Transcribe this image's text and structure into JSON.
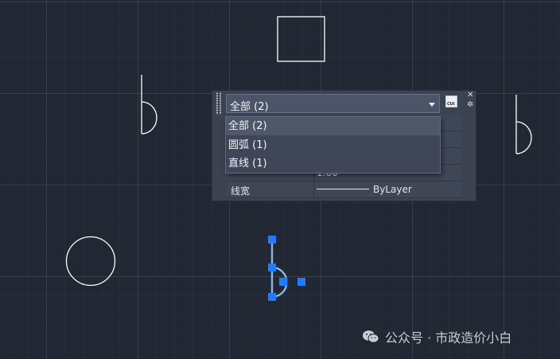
{
  "canvas": {
    "background_color": "#212733",
    "stroke_color": "#ffffff",
    "selection_color": "#3b8eea",
    "grip_color": "#1f7cff",
    "objects": [
      "rectangle",
      "arc-line-glyph",
      "arc-line-glyph",
      "circle",
      "selected-arc-line-glyph"
    ]
  },
  "quick_properties": {
    "selector_value": "全部 (2)",
    "cui_icon_label": "CUI",
    "close_icon": "close-icon",
    "settings_icon": "gear-icon",
    "rows": [
      {
        "label": "",
        "value": ""
      },
      {
        "label": "",
        "value": ""
      },
      {
        "label": "",
        "value": ""
      },
      {
        "label": "",
        "value": "1.00"
      },
      {
        "label": "线宽",
        "value": "ByLayer"
      }
    ]
  },
  "dropdown": {
    "items": [
      {
        "label": "全部 (2)",
        "selected": true
      },
      {
        "label": "圆弧 (1)",
        "selected": false
      },
      {
        "label": "直线 (1)",
        "selected": false
      }
    ]
  },
  "watermark": {
    "icon": "wechat-icon",
    "text": "公众号 · 市政造价小白"
  }
}
